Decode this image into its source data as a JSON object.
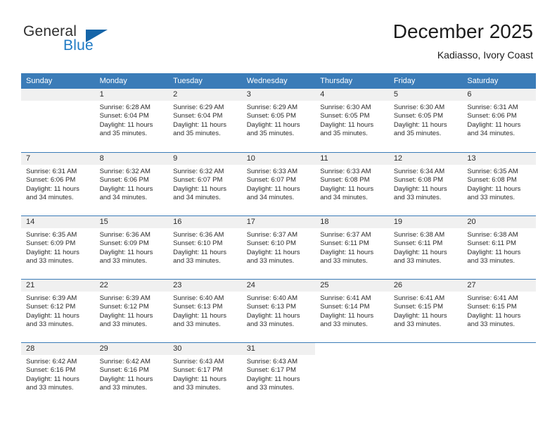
{
  "brand": {
    "name_part1": "General",
    "name_part2": "Blue",
    "flag_icon": "triangle-flag-icon"
  },
  "header": {
    "title": "December 2025",
    "subtitle": "Kadiasso, Ivory Coast"
  },
  "colors": {
    "header_band": "#3b7cb8",
    "daynum_band": "#f0f0f0",
    "brand_blue": "#1f7ac4",
    "flag_blue": "#1565a8",
    "text": "#2b2b2b"
  },
  "weekday_headers": [
    "Sunday",
    "Monday",
    "Tuesday",
    "Wednesday",
    "Thursday",
    "Friday",
    "Saturday"
  ],
  "weeks": [
    [
      {
        "day": "",
        "sunrise": "",
        "sunset": "",
        "daylight_line1": "",
        "daylight_line2": "",
        "empty": true
      },
      {
        "day": "1",
        "sunrise": "Sunrise: 6:28 AM",
        "sunset": "Sunset: 6:04 PM",
        "daylight_line1": "Daylight: 11 hours",
        "daylight_line2": "and 35 minutes."
      },
      {
        "day": "2",
        "sunrise": "Sunrise: 6:29 AM",
        "sunset": "Sunset: 6:04 PM",
        "daylight_line1": "Daylight: 11 hours",
        "daylight_line2": "and 35 minutes."
      },
      {
        "day": "3",
        "sunrise": "Sunrise: 6:29 AM",
        "sunset": "Sunset: 6:05 PM",
        "daylight_line1": "Daylight: 11 hours",
        "daylight_line2": "and 35 minutes."
      },
      {
        "day": "4",
        "sunrise": "Sunrise: 6:30 AM",
        "sunset": "Sunset: 6:05 PM",
        "daylight_line1": "Daylight: 11 hours",
        "daylight_line2": "and 35 minutes."
      },
      {
        "day": "5",
        "sunrise": "Sunrise: 6:30 AM",
        "sunset": "Sunset: 6:05 PM",
        "daylight_line1": "Daylight: 11 hours",
        "daylight_line2": "and 35 minutes."
      },
      {
        "day": "6",
        "sunrise": "Sunrise: 6:31 AM",
        "sunset": "Sunset: 6:06 PM",
        "daylight_line1": "Daylight: 11 hours",
        "daylight_line2": "and 34 minutes."
      }
    ],
    [
      {
        "day": "7",
        "sunrise": "Sunrise: 6:31 AM",
        "sunset": "Sunset: 6:06 PM",
        "daylight_line1": "Daylight: 11 hours",
        "daylight_line2": "and 34 minutes."
      },
      {
        "day": "8",
        "sunrise": "Sunrise: 6:32 AM",
        "sunset": "Sunset: 6:06 PM",
        "daylight_line1": "Daylight: 11 hours",
        "daylight_line2": "and 34 minutes."
      },
      {
        "day": "9",
        "sunrise": "Sunrise: 6:32 AM",
        "sunset": "Sunset: 6:07 PM",
        "daylight_line1": "Daylight: 11 hours",
        "daylight_line2": "and 34 minutes."
      },
      {
        "day": "10",
        "sunrise": "Sunrise: 6:33 AM",
        "sunset": "Sunset: 6:07 PM",
        "daylight_line1": "Daylight: 11 hours",
        "daylight_line2": "and 34 minutes."
      },
      {
        "day": "11",
        "sunrise": "Sunrise: 6:33 AM",
        "sunset": "Sunset: 6:08 PM",
        "daylight_line1": "Daylight: 11 hours",
        "daylight_line2": "and 34 minutes."
      },
      {
        "day": "12",
        "sunrise": "Sunrise: 6:34 AM",
        "sunset": "Sunset: 6:08 PM",
        "daylight_line1": "Daylight: 11 hours",
        "daylight_line2": "and 33 minutes."
      },
      {
        "day": "13",
        "sunrise": "Sunrise: 6:35 AM",
        "sunset": "Sunset: 6:08 PM",
        "daylight_line1": "Daylight: 11 hours",
        "daylight_line2": "and 33 minutes."
      }
    ],
    [
      {
        "day": "14",
        "sunrise": "Sunrise: 6:35 AM",
        "sunset": "Sunset: 6:09 PM",
        "daylight_line1": "Daylight: 11 hours",
        "daylight_line2": "and 33 minutes."
      },
      {
        "day": "15",
        "sunrise": "Sunrise: 6:36 AM",
        "sunset": "Sunset: 6:09 PM",
        "daylight_line1": "Daylight: 11 hours",
        "daylight_line2": "and 33 minutes."
      },
      {
        "day": "16",
        "sunrise": "Sunrise: 6:36 AM",
        "sunset": "Sunset: 6:10 PM",
        "daylight_line1": "Daylight: 11 hours",
        "daylight_line2": "and 33 minutes."
      },
      {
        "day": "17",
        "sunrise": "Sunrise: 6:37 AM",
        "sunset": "Sunset: 6:10 PM",
        "daylight_line1": "Daylight: 11 hours",
        "daylight_line2": "and 33 minutes."
      },
      {
        "day": "18",
        "sunrise": "Sunrise: 6:37 AM",
        "sunset": "Sunset: 6:11 PM",
        "daylight_line1": "Daylight: 11 hours",
        "daylight_line2": "and 33 minutes."
      },
      {
        "day": "19",
        "sunrise": "Sunrise: 6:38 AM",
        "sunset": "Sunset: 6:11 PM",
        "daylight_line1": "Daylight: 11 hours",
        "daylight_line2": "and 33 minutes."
      },
      {
        "day": "20",
        "sunrise": "Sunrise: 6:38 AM",
        "sunset": "Sunset: 6:11 PM",
        "daylight_line1": "Daylight: 11 hours",
        "daylight_line2": "and 33 minutes."
      }
    ],
    [
      {
        "day": "21",
        "sunrise": "Sunrise: 6:39 AM",
        "sunset": "Sunset: 6:12 PM",
        "daylight_line1": "Daylight: 11 hours",
        "daylight_line2": "and 33 minutes."
      },
      {
        "day": "22",
        "sunrise": "Sunrise: 6:39 AM",
        "sunset": "Sunset: 6:12 PM",
        "daylight_line1": "Daylight: 11 hours",
        "daylight_line2": "and 33 minutes."
      },
      {
        "day": "23",
        "sunrise": "Sunrise: 6:40 AM",
        "sunset": "Sunset: 6:13 PM",
        "daylight_line1": "Daylight: 11 hours",
        "daylight_line2": "and 33 minutes."
      },
      {
        "day": "24",
        "sunrise": "Sunrise: 6:40 AM",
        "sunset": "Sunset: 6:13 PM",
        "daylight_line1": "Daylight: 11 hours",
        "daylight_line2": "and 33 minutes."
      },
      {
        "day": "25",
        "sunrise": "Sunrise: 6:41 AM",
        "sunset": "Sunset: 6:14 PM",
        "daylight_line1": "Daylight: 11 hours",
        "daylight_line2": "and 33 minutes."
      },
      {
        "day": "26",
        "sunrise": "Sunrise: 6:41 AM",
        "sunset": "Sunset: 6:15 PM",
        "daylight_line1": "Daylight: 11 hours",
        "daylight_line2": "and 33 minutes."
      },
      {
        "day": "27",
        "sunrise": "Sunrise: 6:41 AM",
        "sunset": "Sunset: 6:15 PM",
        "daylight_line1": "Daylight: 11 hours",
        "daylight_line2": "and 33 minutes."
      }
    ],
    [
      {
        "day": "28",
        "sunrise": "Sunrise: 6:42 AM",
        "sunset": "Sunset: 6:16 PM",
        "daylight_line1": "Daylight: 11 hours",
        "daylight_line2": "and 33 minutes."
      },
      {
        "day": "29",
        "sunrise": "Sunrise: 6:42 AM",
        "sunset": "Sunset: 6:16 PM",
        "daylight_line1": "Daylight: 11 hours",
        "daylight_line2": "and 33 minutes."
      },
      {
        "day": "30",
        "sunrise": "Sunrise: 6:43 AM",
        "sunset": "Sunset: 6:17 PM",
        "daylight_line1": "Daylight: 11 hours",
        "daylight_line2": "and 33 minutes."
      },
      {
        "day": "31",
        "sunrise": "Sunrise: 6:43 AM",
        "sunset": "Sunset: 6:17 PM",
        "daylight_line1": "Daylight: 11 hours",
        "daylight_line2": "and 33 minutes."
      },
      {
        "day": "",
        "sunrise": "",
        "sunset": "",
        "daylight_line1": "",
        "daylight_line2": "",
        "blank": true
      },
      {
        "day": "",
        "sunrise": "",
        "sunset": "",
        "daylight_line1": "",
        "daylight_line2": "",
        "blank": true
      },
      {
        "day": "",
        "sunrise": "",
        "sunset": "",
        "daylight_line1": "",
        "daylight_line2": "",
        "blank": true
      }
    ]
  ]
}
